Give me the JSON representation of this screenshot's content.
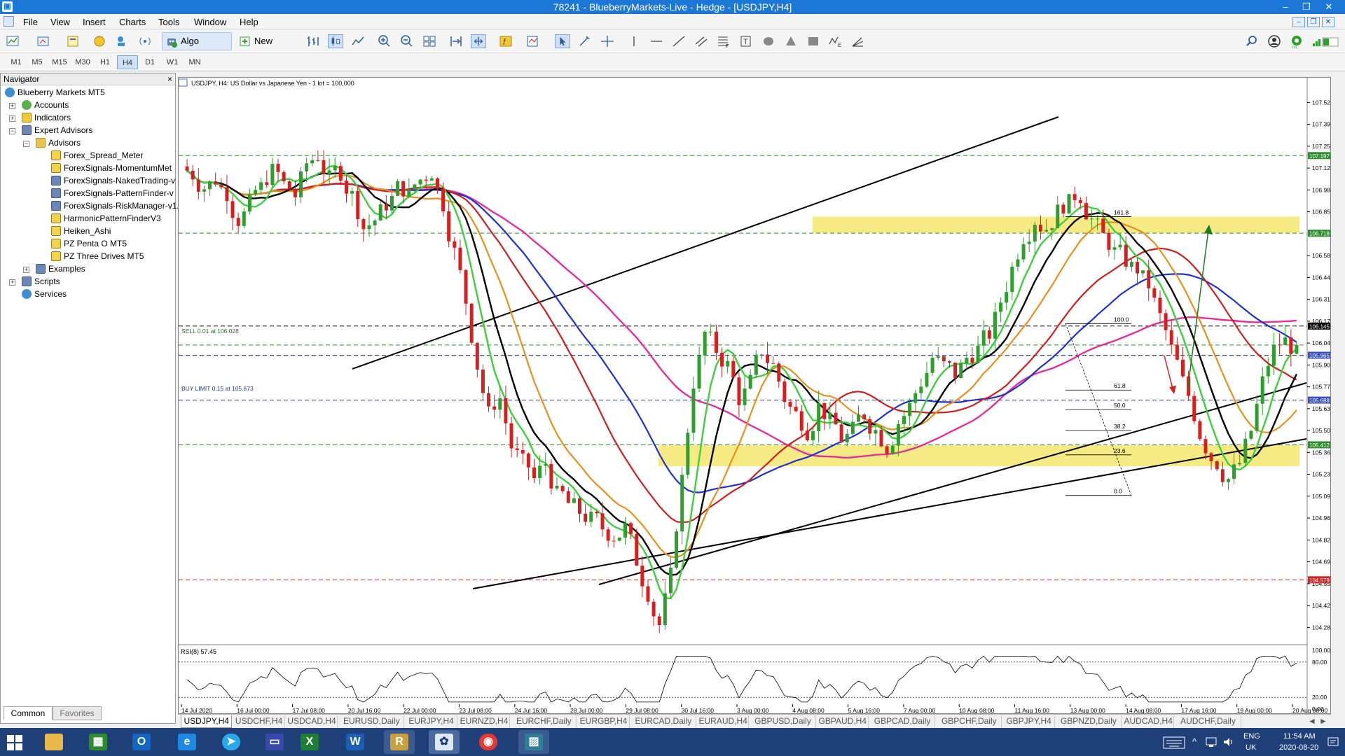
{
  "window": {
    "title": "78241 - BlueberryMarkets-Live - Hedge - [USDJPY,H4]"
  },
  "menu": [
    "File",
    "View",
    "Insert",
    "Charts",
    "Tools",
    "Window",
    "Help"
  ],
  "toolbar": {
    "algo_trading": "Algo Trading",
    "new_order": "New Order"
  },
  "timeframes": [
    "M1",
    "M5",
    "M15",
    "M30",
    "H1",
    "H4",
    "D1",
    "W1",
    "MN"
  ],
  "active_timeframe": "H4",
  "navigator": {
    "title": "Navigator",
    "close": "×",
    "root": "Blueberry Markets MT5",
    "accounts": "Accounts",
    "indicators": "Indicators",
    "expert_advisors": "Expert Advisors",
    "advisors": "Advisors",
    "advisor_items": [
      "Forex_Spread_Meter",
      "ForexSignals-MomentumMet",
      "ForexSignals-NakedTrading-v",
      "ForexSignals-PatternFinder-v",
      "ForexSignals-RiskManager-v1.",
      "HarmonicPatternFinderV3",
      "Heiken_Ashi",
      "PZ Penta O MT5",
      "PZ Three Drives MT5"
    ],
    "examples": "Examples",
    "scripts": "Scripts",
    "services": "Services",
    "tabs": [
      "Common",
      "Favorites"
    ]
  },
  "chart": {
    "header": "USDJPY, H4:  US Dollar vs Japanese Yen - 1 lot = 100,000",
    "sell_label": "SELL 0.01 at 106.028",
    "buy_label": "BUY LIMIT 0.15 at 105.673",
    "rsi_label": "RSI(8) 57.45",
    "rsi_ticks": [
      "100.00",
      "80.00",
      "20.00",
      "0.00"
    ]
  },
  "chart_data": {
    "type": "candlestick",
    "symbol": "USDJPY",
    "timeframe": "H4",
    "y_ticks": [
      107.525,
      107.39,
      107.255,
      107.12,
      106.985,
      106.85,
      106.58,
      106.445,
      106.31,
      106.175,
      106.04,
      105.905,
      105.77,
      105.635,
      105.5,
      105.365,
      105.23,
      105.095,
      104.96,
      104.825,
      104.69,
      104.555,
      104.42,
      104.285
    ],
    "ylim": [
      104.2,
      107.6
    ],
    "x_ticks": [
      "14 Jul 2020",
      "16 Jul 00:00",
      "17 Jul 08:00",
      "20 Jul 16:00",
      "22 Jul 00:00",
      "23 Jul 08:00",
      "24 Jul 16:00",
      "28 Jul 00:00",
      "29 Jul 08:00",
      "30 Jul 16:00",
      "3 Aug 00:00",
      "4 Aug 08:00",
      "5 Aug 16:00",
      "7 Aug 00:00",
      "10 Aug 08:00",
      "11 Aug 16:00",
      "13 Aug 00:00",
      "14 Aug 08:00",
      "17 Aug 16:00",
      "19 Aug 00:00",
      "20 Aug 08:00"
    ],
    "price_levels": [
      {
        "value": 107.197,
        "label": "107.197",
        "color": "#2e8b2e"
      },
      {
        "value": 106.718,
        "label": "106.718",
        "color": "#2e8b2e"
      },
      {
        "value": 106.145,
        "label": "106.145",
        "color": "#000000"
      },
      {
        "value": 106.028,
        "label": "106.028",
        "color": "#2e8b2e"
      },
      {
        "value": 105.965,
        "label": "105.965",
        "color": "#1e3a8a"
      },
      {
        "value": 105.688,
        "label": "105.688",
        "color": "#1e3a8a"
      },
      {
        "value": 105.412,
        "label": "105.412",
        "color": "#2e8b2e"
      },
      {
        "value": 104.579,
        "label": "104.579",
        "color": "#d02020"
      }
    ],
    "price_badges": [
      {
        "value": 107.197,
        "label": "107.197",
        "color": "#2e8b2e"
      },
      {
        "value": 106.718,
        "label": "106.718",
        "color": "#2e8b2e"
      },
      {
        "value": 106.145,
        "label": "106.145",
        "color": "#000000"
      },
      {
        "value": 105.965,
        "label": "105.965",
        "color": "#3a4fc0"
      },
      {
        "value": 105.688,
        "label": "105.688",
        "color": "#3a4fc0"
      },
      {
        "value": 105.412,
        "label": "105.412",
        "color": "#2e8b2e"
      },
      {
        "value": 104.579,
        "label": "104.579",
        "color": "#d02020"
      }
    ],
    "fib_levels": [
      {
        "label": "161.8",
        "value": 106.82
      },
      {
        "label": "100.0",
        "value": 106.16
      },
      {
        "label": "61.8",
        "value": 105.75
      },
      {
        "label": "50.0",
        "value": 105.63
      },
      {
        "label": "38.2",
        "value": 105.5
      },
      {
        "label": "23.6",
        "value": 105.35
      },
      {
        "label": "0.0",
        "value": 105.1
      }
    ],
    "zones": [
      {
        "from": 106.72,
        "to": 106.82
      },
      {
        "from": 105.28,
        "to": 105.41
      }
    ],
    "series": [
      {
        "name": "Close",
        "values": [
          107.08,
          107.0,
          107.05,
          106.97,
          106.8,
          106.9,
          107.0,
          107.1,
          107.02,
          106.95,
          107.15,
          107.2,
          107.05,
          107.1,
          106.95,
          106.75,
          106.8,
          106.9,
          107.0,
          106.95,
          107.05,
          107.1,
          106.9,
          106.6,
          106.3,
          105.9,
          105.6,
          105.7,
          105.4,
          105.3,
          105.2,
          105.3,
          105.1,
          105.05,
          105.0,
          104.95,
          104.9,
          104.85,
          104.9,
          104.7,
          104.5,
          104.3,
          104.6,
          105.2,
          105.8,
          106.1,
          106.0,
          105.9,
          105.7,
          105.8,
          106.0,
          105.9,
          105.7,
          105.6,
          105.5,
          105.65,
          105.55,
          105.45,
          105.5,
          105.6,
          105.5,
          105.4,
          105.55,
          105.65,
          105.8,
          105.95,
          105.9,
          105.85,
          105.95,
          106.0,
          106.1,
          106.3,
          106.5,
          106.7,
          106.8,
          106.75,
          106.85,
          106.9,
          106.95,
          106.8,
          106.7,
          106.6,
          106.55,
          106.5,
          106.4,
          106.2,
          106.0,
          105.8,
          105.6,
          105.4,
          105.3,
          105.2,
          105.3,
          105.5,
          105.8,
          106.0,
          106.05,
          105.97
        ]
      }
    ]
  },
  "symbol_tabs": [
    "USDJPY,H4",
    "USDCHF,H4",
    "USDCAD,H4",
    "EURUSD,Daily",
    "EURJPY,H4",
    "EURNZD,H4",
    "EURCHF,Daily",
    "EURGBP,H4",
    "EURCAD,Daily",
    "EURAUD,H4",
    "GBPUSD,Daily",
    "GBPAUD,H4",
    "GBPCAD,Daily",
    "GBPCHF,Daily",
    "GBPJPY,H4",
    "GBPNZD,Daily",
    "AUDCAD,H4",
    "AUDCHF,Daily"
  ],
  "taskbar": {
    "lang": "ENG",
    "region": "UK",
    "time": "11:54 AM",
    "date": "2020-08-20"
  },
  "colors": {
    "titlebar": "#1c77d6",
    "bull": "#2e9e2e",
    "bear": "#d42020",
    "ma_green": "#3ecf3e",
    "ma_orange": "#e8901c",
    "ma_black": "#000000",
    "ma_red": "#cc2020",
    "ma_blue": "#2030d0",
    "ma_magenta": "#e0309a",
    "zone": "#f4e66e"
  }
}
